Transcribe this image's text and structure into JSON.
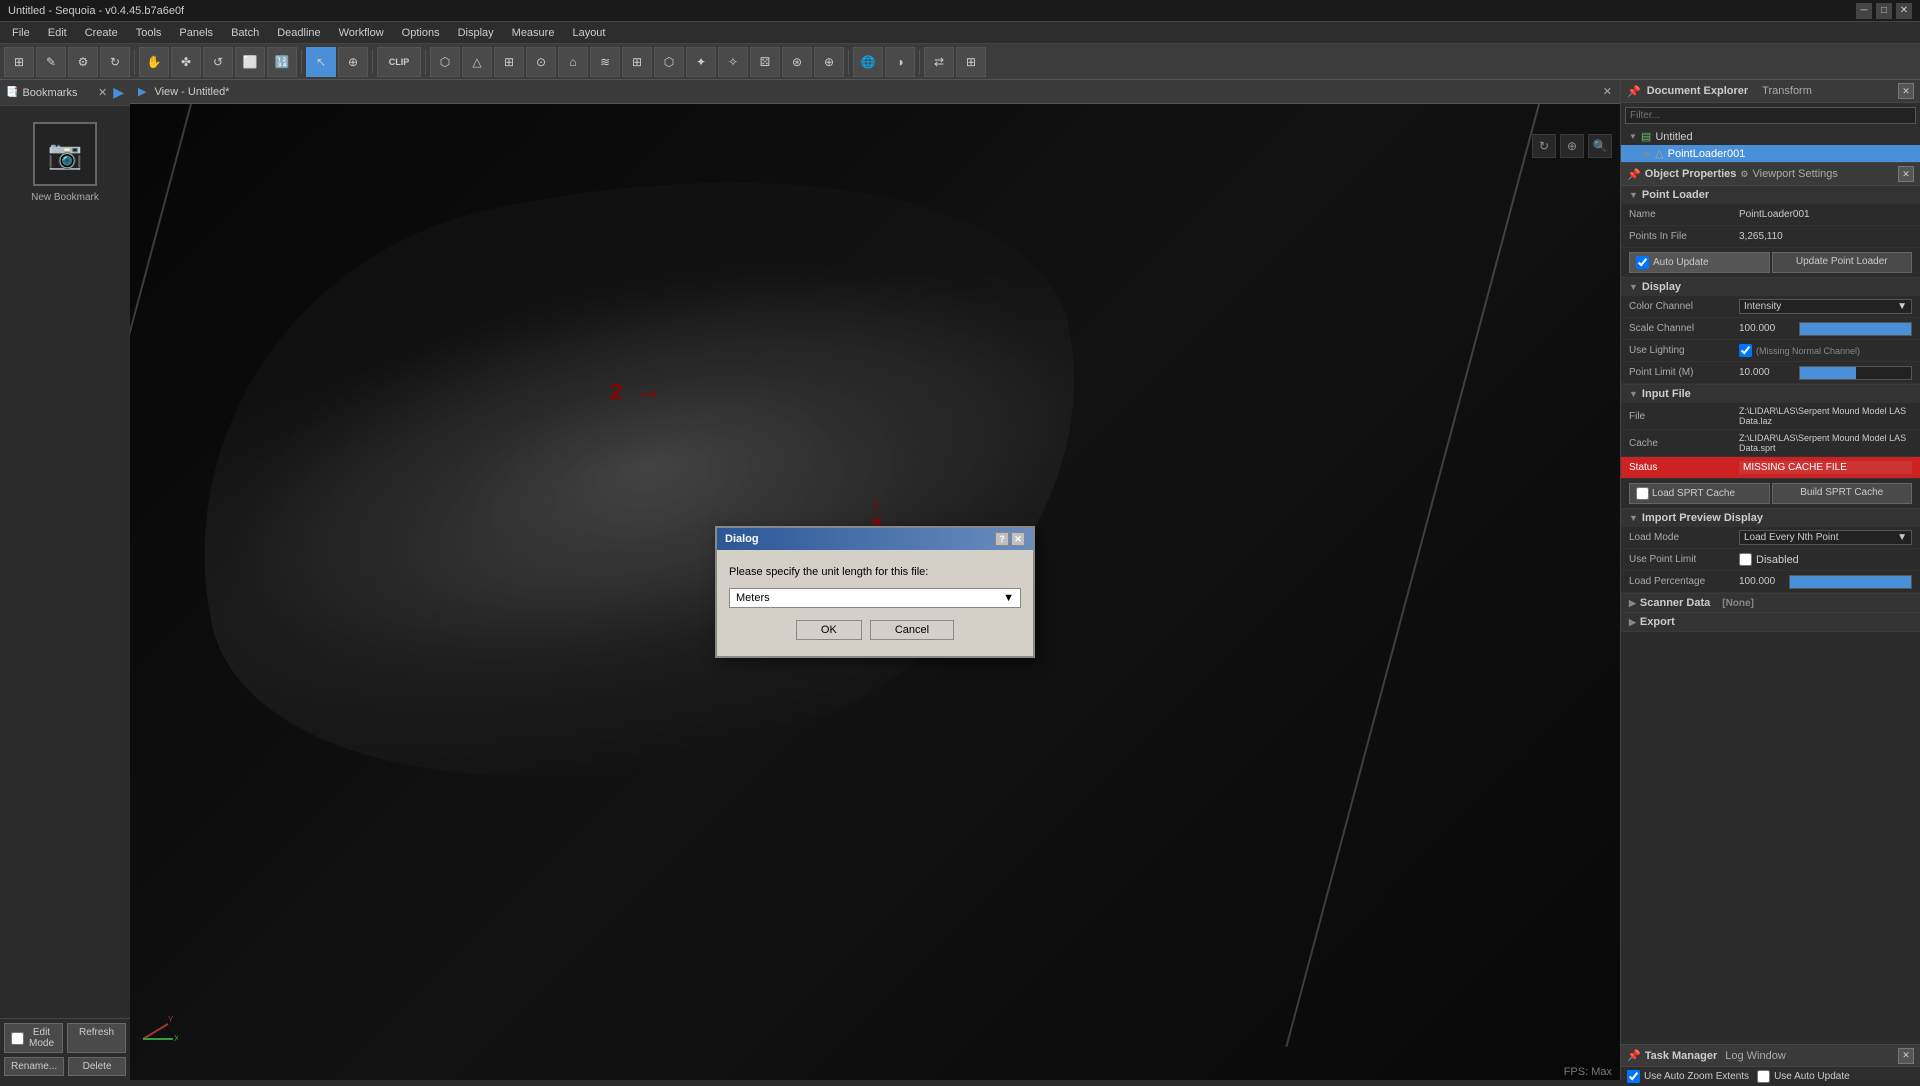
{
  "app": {
    "title": "Untitled - Sequoia - v0.4.45.b7a6e0f",
    "window_controls": [
      "─",
      "□",
      "✕"
    ]
  },
  "menubar": {
    "items": [
      "File",
      "Edit",
      "Create",
      "Tools",
      "Panels",
      "Batch",
      "Deadline",
      "Workflow",
      "Options",
      "Display",
      "Measure",
      "Layout"
    ]
  },
  "viewport": {
    "tab": "View - Untitled*",
    "fps": "FPS: Max"
  },
  "bookmarks": {
    "label": "Bookmarks",
    "new_bookmark": "New Bookmark",
    "camera_icon": "📷"
  },
  "bottom_controls": {
    "edit_mode_label": "Edit Mode",
    "refresh_label": "Refresh",
    "rename_label": "Rename...",
    "delete_label": "Delete"
  },
  "doc_explorer": {
    "title": "Document Explorer",
    "transform": "Transform",
    "filter_placeholder": "Filter...",
    "items": [
      {
        "label": "Untitled",
        "icon": "▤",
        "expanded": true,
        "level": 0
      },
      {
        "label": "PointLoader001",
        "icon": "△",
        "expanded": false,
        "level": 1,
        "selected": true
      }
    ]
  },
  "properties": {
    "title": "Object Properties",
    "viewport_settings": "Viewport Settings",
    "sections": {
      "point_loader": {
        "label": "Point Loader",
        "name_label": "Name",
        "name_value": "PointLoader001",
        "points_label": "Points In File",
        "points_value": "3,265,110",
        "auto_update_label": "Auto Update",
        "update_btn": "Update Point Loader"
      },
      "display": {
        "label": "Display",
        "color_channel_label": "Color Channel",
        "color_channel_value": "Intensity",
        "scale_channel_label": "Scale Channel",
        "scale_channel_value": "100.000",
        "use_lighting_label": "Use Lighting",
        "use_lighting_note": "(Missing Normal Channel)",
        "point_limit_label": "Point Limit (M)",
        "point_limit_value": "10.000"
      },
      "input_file": {
        "label": "Input File",
        "file_label": "File",
        "file_value": "Z:\\LIDAR\\LAS\\Serpent Mound Model LAS Data.laz",
        "cache_label": "Cache",
        "cache_value": "Z:\\LIDAR\\LAS\\Serpent Mound Model LAS Data.sprt",
        "status_label": "Status",
        "status_value": "MISSING CACHE FILE",
        "load_sprt_label": "Load SPRT Cache",
        "build_sprt_label": "Build SPRT Cache"
      },
      "import_preview": {
        "label": "Import Preview Display",
        "load_mode_label": "Load Mode",
        "load_mode_value": "Load Every Nth Point",
        "use_point_limit_label": "Use Point Limit",
        "disabled_label": "Disabled",
        "load_percentage_label": "Load Percentage",
        "load_percentage_value": "100.000"
      },
      "scanner_data": {
        "label": "Scanner Data",
        "value": "[None]"
      },
      "export": {
        "label": "Export"
      }
    }
  },
  "task_manager": {
    "title": "Task Manager",
    "log_window": "Log Window",
    "auto_zoom": "Use Auto Zoom Extents",
    "auto_update": "Use Auto Update"
  },
  "dialog": {
    "title": "Dialog",
    "prompt": "Please specify the unit length for this file:",
    "select_label": "Meters",
    "ok_label": "OK",
    "cancel_label": "Cancel"
  },
  "annotations": {
    "arrow2_label": "2",
    "arrow3_label": "3",
    "arrow_icon": "↑"
  }
}
